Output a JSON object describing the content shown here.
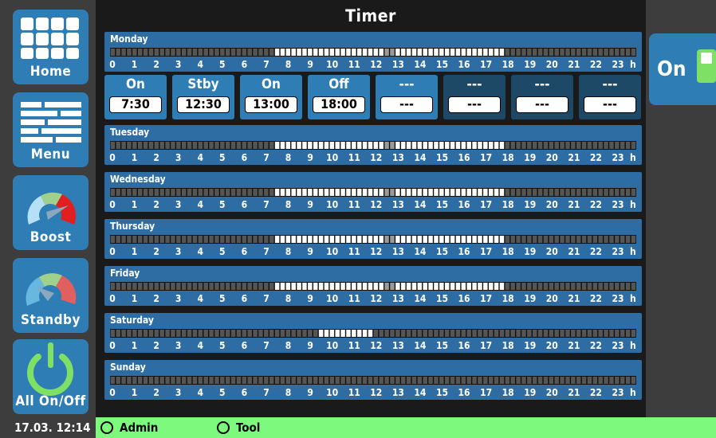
{
  "header": {
    "title": "Timer"
  },
  "sidebar": {
    "home_label": "Home",
    "menu_label": "Menu",
    "boost_label": "Boost",
    "standby_label": "Standby",
    "all_on_off_label": "All On/Off"
  },
  "toggle": {
    "state": "On"
  },
  "hour_labels": [
    "0",
    "1",
    "2",
    "3",
    "4",
    "5",
    "6",
    "7",
    "8",
    "9",
    "10",
    "11",
    "12",
    "13",
    "14",
    "15",
    "16",
    "17",
    "18",
    "19",
    "20",
    "21",
    "22",
    "23"
  ],
  "hour_suffix": "h",
  "days": [
    {
      "name": "Monday",
      "active_from_hour": 7.5,
      "active_to_hour": 18.0,
      "standby_from_hour": 12.5,
      "standby_to_hour": 13.0
    },
    {
      "name": "Tuesday",
      "active_from_hour": 7.5,
      "active_to_hour": 18.0,
      "standby_from_hour": 12.5,
      "standby_to_hour": 13.0
    },
    {
      "name": "Wednesday",
      "active_from_hour": 7.5,
      "active_to_hour": 18.0,
      "standby_from_hour": 12.5,
      "standby_to_hour": 13.0
    },
    {
      "name": "Thursday",
      "active_from_hour": 7.5,
      "active_to_hour": 18.0,
      "standby_from_hour": 12.5,
      "standby_to_hour": 13.0
    },
    {
      "name": "Friday",
      "active_from_hour": 7.5,
      "active_to_hour": 18.0,
      "standby_from_hour": 12.5,
      "standby_to_hour": 13.0
    },
    {
      "name": "Saturday",
      "active_from_hour": 9.5,
      "active_to_hour": 12.0,
      "standby_from_hour": null,
      "standby_to_hour": null
    },
    {
      "name": "Sunday",
      "active_from_hour": null,
      "active_to_hour": null,
      "standby_from_hour": null,
      "standby_to_hour": null
    }
  ],
  "monday_slots": [
    {
      "mode": "On",
      "time": "7:30"
    },
    {
      "mode": "Stby",
      "time": "12:30"
    },
    {
      "mode": "On",
      "time": "13:00"
    },
    {
      "mode": "Off",
      "time": "18:00"
    },
    {
      "mode": "---",
      "time": "---"
    },
    {
      "mode": "---",
      "time": "---"
    },
    {
      "mode": "---",
      "time": "---"
    },
    {
      "mode": "---",
      "time": "---"
    }
  ],
  "footer": {
    "datetime": "17.03. 12:14",
    "user_label": "Admin",
    "tool_label": "Tool"
  },
  "colors": {
    "panel_blue": "#2e6da4",
    "button_blue": "#2e7db5",
    "active_segment": "#ffffff",
    "inactive_segment": "#555555",
    "standby_segment": "#9a9a9a",
    "status_green": "#7dfa7d"
  }
}
